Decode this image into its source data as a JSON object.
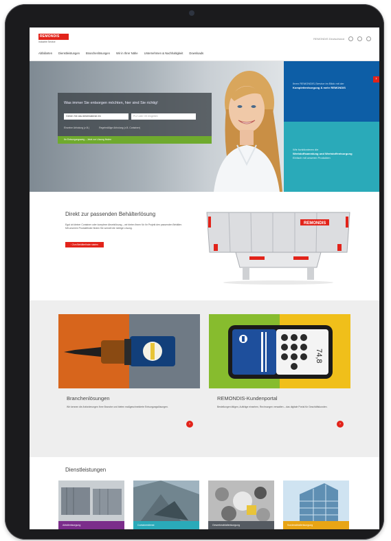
{
  "header": {
    "logo_text": "REMONDIS",
    "logo_sub": "Industrie Service",
    "utility_text": "REMONDIS Deutschland",
    "nav": [
      "Abfallarten",
      "Dienstleistungen",
      "Branchenlösungen",
      "Wir in Ihrer Nähe",
      "Unternehmen & Nachhaltigkeit",
      "Downloads"
    ]
  },
  "hero": {
    "question": "Was immer Sie entsorgen möchten, hier sind Sie richtig!",
    "input1_placeholder": "Geben Sie das Abfallmaterial ein",
    "input2_placeholder": "PLZ oder Ort eingeben",
    "option1": "Einzelne Abholung (z.B.)",
    "option2": "Regelmäßige Abholung (z.B. Container)",
    "go_label": "Ihr Entsorgungsweg – Jetzt zur Lösung finden",
    "tile1_text": "Ihren REMONDIS-Service im Blick mit der",
    "tile1_bold": "Komplettentsorgung & mehr REMONDIS",
    "tile1_arrow": "›",
    "tile2_text": "Wie funktionieren die",
    "tile2_bold": "Wertstoffsammlung und Wertstoffentsorgung",
    "tile2_rest": "Einfach mit unseren Produkten"
  },
  "container_section": {
    "heading": "Direkt zur passenden Behälterlösung",
    "text": "Egal ob kleiner Container oder komplexe Absetzlösung – wir bieten Ihnen für Ihr Projekt den passenden Behälter. Mit unserem Produktfinder finden Sie schnell die richtige Lösung.",
    "button": "› Zum Behälterfinder starten",
    "container_logo": "REMONDIS"
  },
  "cards": [
    {
      "title": "Branchenlösungen",
      "desc": "Wir kennen die Anforderungen Ihrer Branche und bieten maßgeschneiderte Entsorgungslösungen.",
      "arrow": "›"
    },
    {
      "title": "REMONDIS-Kundenportal",
      "desc": "Bestellungen tätigen, Aufträge einsehen, Rechnungen verwalten – das digitale Portal für Geschäftskunden.",
      "arrow": "›",
      "phone_text": "74,8"
    }
  ],
  "services": {
    "heading": "Dienstleistungen",
    "items": [
      {
        "label": "Abfallentsorgung",
        "color": "#7b2d8b"
      },
      {
        "label": "Containerdienst",
        "color": "#2aaab9"
      },
      {
        "label": "Gewerbeabfallentsorgung",
        "color": "#555b62"
      },
      {
        "label": "Sonderabfallentsorgung",
        "color": "#e8a515"
      }
    ]
  }
}
